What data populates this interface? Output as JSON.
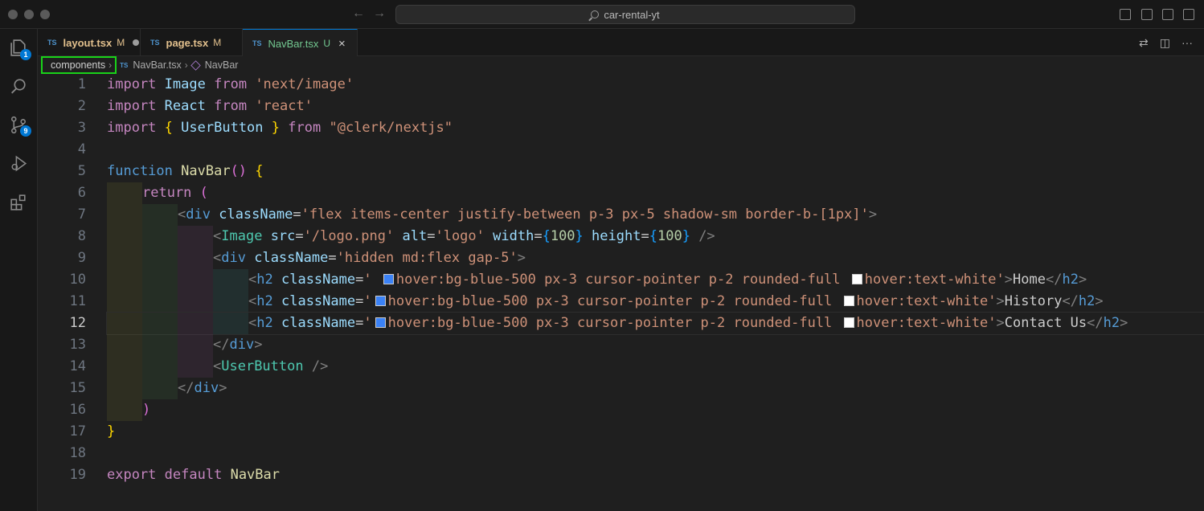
{
  "window": {
    "title": "car-rental-yt"
  },
  "activity": {
    "explorer_badge": "1",
    "scm_badge": "9"
  },
  "tabs": [
    {
      "lang": "TS",
      "name": "layout.tsx",
      "status": "M"
    },
    {
      "lang": "TS",
      "name": "page.tsx",
      "status": "M"
    },
    {
      "lang": "TS",
      "name": "NavBar.tsx",
      "status": "U"
    }
  ],
  "breadcrumb": {
    "folder": "components",
    "lang": "TS",
    "file": "NavBar.tsx",
    "symbol": "NavBar"
  },
  "colors": {
    "blue_swatch": "#3b82f6",
    "white_swatch": "#ffffff",
    "highlight_box": "#19d319"
  },
  "editor": {
    "line_numbers": [
      "1",
      "2",
      "3",
      "4",
      "5",
      "6",
      "7",
      "8",
      "9",
      "10",
      "11",
      "12",
      "13",
      "14",
      "15",
      "16",
      "17",
      "18",
      "19"
    ],
    "active_line": "12",
    "lines": {
      "l1": {
        "kw": "import",
        "id": "Image",
        "from": "from",
        "str": "'next/image'"
      },
      "l2": {
        "kw": "import",
        "id": "React",
        "from": "from",
        "str": "'react'"
      },
      "l3": {
        "kw": "import",
        "ob": "{",
        "id": "UserButton",
        "cb": "}",
        "from": "from",
        "str": "\"@clerk/nextjs\""
      },
      "l5": {
        "kw": "function",
        "fn": "NavBar",
        "paren": "()",
        "brace": "{"
      },
      "l6": {
        "kw": "return",
        "paren": "("
      },
      "l7": {
        "lt": "<",
        "tag": "div",
        "attr": "className",
        "eq": "=",
        "str": "'flex items-center justify-between p-3 px-5 shadow-sm border-b-[1px]'",
        "gt": ">"
      },
      "l8": {
        "lt": "<",
        "tag": "Image",
        "a1": "src",
        "v1": "'/logo.png'",
        "a2": "alt",
        "v2": "'logo'",
        "a3": "width",
        "v3": "100",
        "a4": "height",
        "v4": "100",
        "end": "/>"
      },
      "l9": {
        "lt": "<",
        "tag": "div",
        "attr": "className",
        "str": "'hidden md:flex gap-5'",
        "gt": ">"
      },
      "l10": {
        "tag": "h2",
        "attr": "className",
        "q": "' ",
        "s1": "hover:bg-blue-500 px-3 cursor-pointer p-2 rounded-full ",
        "s2": "hover:text-white'",
        "text": "Home"
      },
      "l11": {
        "tag": "h2",
        "attr": "className",
        "q": "'",
        "s1": "hover:bg-blue-500 px-3 cursor-pointer p-2 rounded-full ",
        "s2": "hover:text-white'",
        "text": "History"
      },
      "l12": {
        "tag": "h2",
        "attr": "className",
        "q": "'",
        "s1": "hover:bg-blue-500 px-3 cursor-pointer p-2 rounded-full ",
        "s2": "hover:text-white'",
        "text": "Contact Us"
      },
      "l13": {
        "tag": "div"
      },
      "l14": {
        "comp": "UserButton",
        "end": "/>"
      },
      "l15": {
        "tag": "div"
      },
      "l16": {
        "paren": ")"
      },
      "l17": {
        "brace": "}"
      },
      "l19": {
        "kw": "export",
        "kw2": "default",
        "id": "NavBar"
      }
    }
  }
}
